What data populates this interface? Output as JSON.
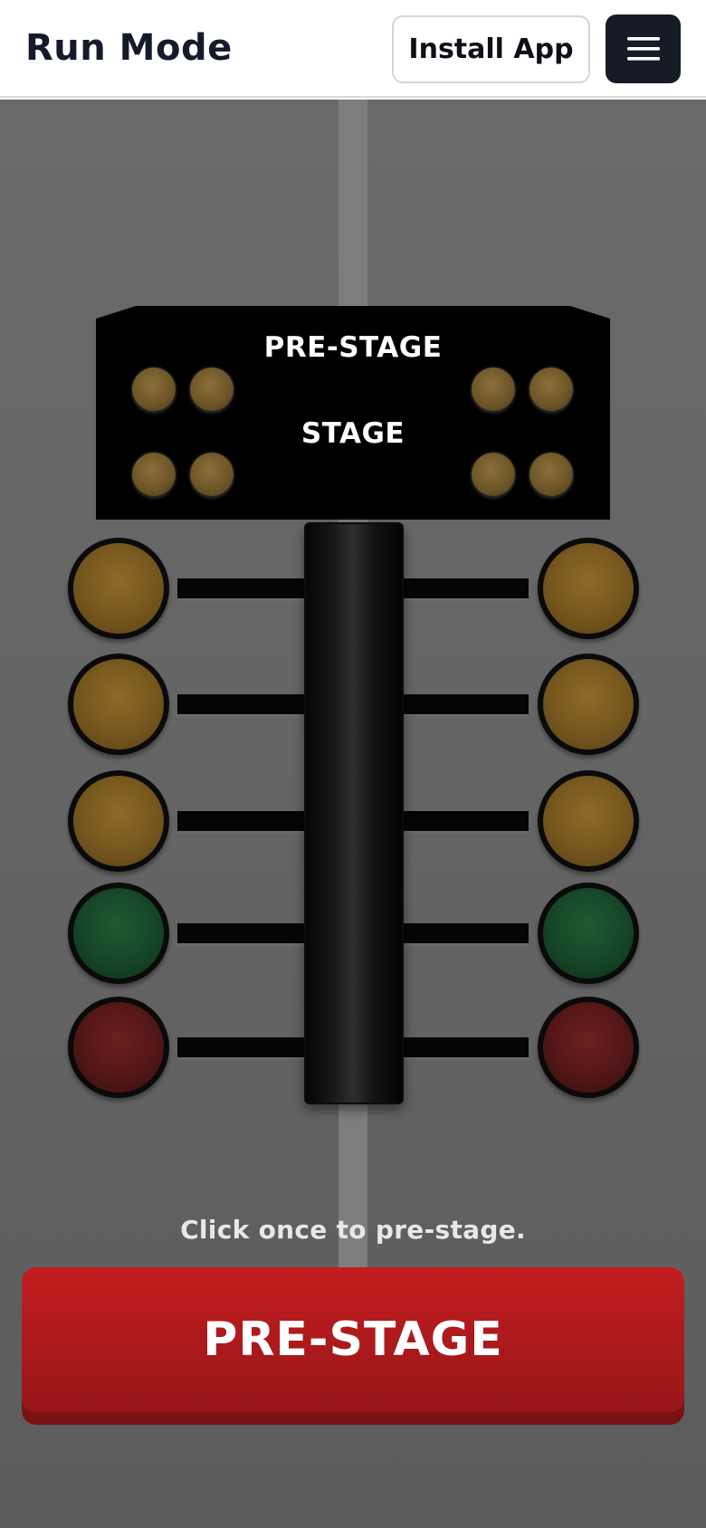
{
  "header": {
    "title": "Run Mode",
    "install_label": "Install App",
    "menu_icon": "hamburger-menu-icon"
  },
  "staging": {
    "prestage_label": "PRE-STAGE",
    "stage_label": "STAGE",
    "bulb_color": "#6e5628"
  },
  "tree": {
    "rows": [
      {
        "color": "amber"
      },
      {
        "color": "amber"
      },
      {
        "color": "amber"
      },
      {
        "color": "green"
      },
      {
        "color": "red"
      }
    ]
  },
  "footer": {
    "hint": "Click once to pre-stage.",
    "button_label": "PRE-STAGE",
    "button_color": "#ad1a1c"
  },
  "colors": {
    "header_text": "#141a2a",
    "menu_bg": "#161b26",
    "track": "#646464",
    "stripe": "#7d7d7d"
  }
}
